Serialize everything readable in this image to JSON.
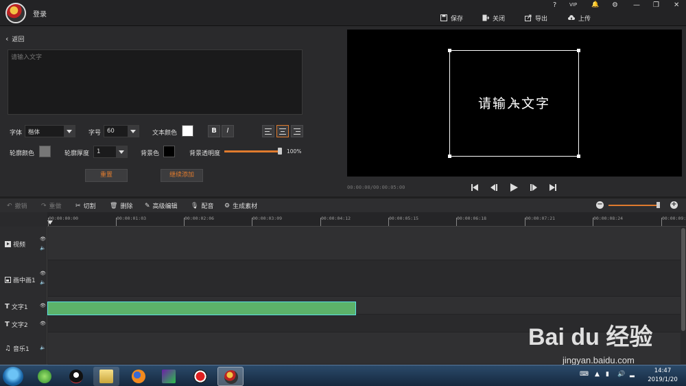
{
  "app": {
    "login_label": "登录",
    "window_controls": [
      "?",
      "VIP",
      "🔔",
      "⚙",
      "—",
      "❐",
      "✕"
    ]
  },
  "top_actions": [
    {
      "label": "保存",
      "icon": "save-icon"
    },
    {
      "label": "关闭",
      "icon": "close-door-icon"
    },
    {
      "label": "导出",
      "icon": "export-icon"
    },
    {
      "label": "上传",
      "icon": "upload-cloud-icon"
    }
  ],
  "editor": {
    "back_label": "返回",
    "text_placeholder": "请输入文字",
    "font_label": "字体",
    "font_value": "楷体",
    "size_label": "字号",
    "size_value": "60",
    "text_color_label": "文本颜色",
    "text_color": "#ffffff",
    "bold_label": "B",
    "italic_label": "I",
    "outline_color_label": "轮廓颜色",
    "outline_color": "#777777",
    "outline_width_label": "轮廓厚度",
    "outline_width_value": "1",
    "bg_color_label": "背景色",
    "bg_color": "#000000",
    "bg_opacity_label": "背景透明度",
    "bg_opacity_value": "100%",
    "bg_opacity_fraction": 1.0,
    "reset_label": "重置",
    "continue_add_label": "继续添加",
    "alignment_selected": "center"
  },
  "preview": {
    "text": "请输入文字",
    "timecode": "00:00:00/00:00:05:00"
  },
  "toolbar": {
    "undo": "撤销",
    "redo": "重做",
    "cut": "切割",
    "delete": "删除",
    "advanced_edit": "高级编辑",
    "dub": "配音",
    "generate_material": "生成素材"
  },
  "ruler": {
    "ticks": [
      "00:00:00:00",
      "00:00:01:03",
      "00:00:02:06",
      "00:00:03:09",
      "00:00:04:12",
      "00:00:05:15",
      "00:00:06:18",
      "00:00:07:21",
      "00:00:08:24",
      "00:00:09:"
    ]
  },
  "tracks": [
    {
      "label": "视频",
      "icon": "video-track-icon"
    },
    {
      "label": "画中画1",
      "icon": "pip-track-icon"
    },
    {
      "label": "文字1",
      "icon": "text-track-icon"
    },
    {
      "label": "文字2",
      "icon": "text-track-icon"
    },
    {
      "label": "音乐1",
      "icon": "music-track-icon"
    }
  ],
  "taskbar": {
    "time": "14:47",
    "date": "2019/1/20"
  },
  "watermark": {
    "brand": "Bai du 经验",
    "url": "jingyan.baidu.com"
  },
  "colors": {
    "accent": "#e07b2e",
    "clip_fill": "#5cb26a",
    "clip_border": "#59e0e6"
  }
}
